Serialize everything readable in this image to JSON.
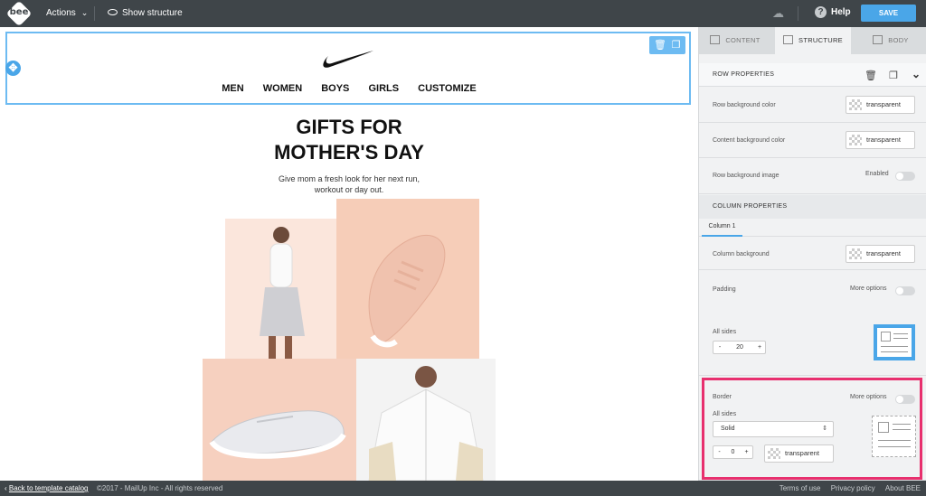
{
  "topbar": {
    "logo_text": "bee",
    "actions_label": "Actions",
    "show_structure_label": "Show structure",
    "help_label": "Help",
    "save_label": "SAVE"
  },
  "email": {
    "nav": [
      "MEN",
      "WOMEN",
      "BOYS",
      "GIRLS",
      "CUSTOMIZE"
    ],
    "title": "GIFTS FOR\nMOTHER'S DAY",
    "subtitle": "Give mom a fresh look for her next run,\nworkout or day out."
  },
  "panel": {
    "tabs": [
      {
        "label": "CONTENT",
        "active": false
      },
      {
        "label": "STRUCTURE",
        "active": true
      },
      {
        "label": "BODY",
        "active": false
      }
    ],
    "row_properties": {
      "header": "ROW PROPERTIES",
      "row_bg_color_label": "Row background color",
      "row_bg_color_value": "transparent",
      "content_bg_color_label": "Content background color",
      "content_bg_color_value": "transparent",
      "row_bg_image_label": "Row background image",
      "row_bg_image_toggle_label": "Enabled"
    },
    "column_properties": {
      "header": "COLUMN PROPERTIES",
      "column_tab": "Column 1",
      "column_bg_label": "Column background",
      "column_bg_value": "transparent",
      "padding_label": "Padding",
      "padding_more_options": "More options",
      "all_sides_label": "All sides",
      "padding_value": "20",
      "border_label": "Border",
      "border_more_options": "More options",
      "border_all_sides_label": "All sides",
      "border_style": "Solid",
      "border_width": "0",
      "border_color": "transparent"
    }
  },
  "footer": {
    "back_link": "Back to template catalog",
    "copyright": "©2017 - MailUp Inc - All rights reserved",
    "links": [
      "Terms of use",
      "Privacy policy",
      "About BEE"
    ]
  },
  "colors": {
    "accent": "#4aa6e8",
    "highlight": "#e8306e",
    "topbar": "#3f4549"
  }
}
